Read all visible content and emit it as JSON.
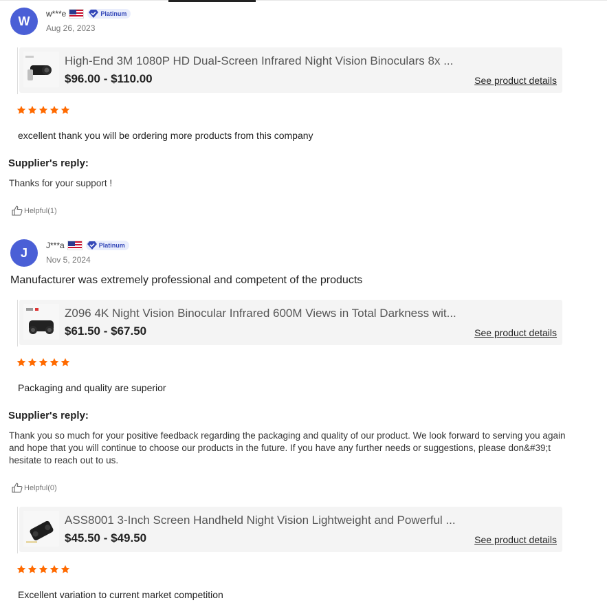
{
  "reviews": [
    {
      "avatar_letter": "W",
      "author": "w***e",
      "country_flag": "us-flag",
      "badge": "Platinum",
      "date": "Aug 26, 2023",
      "text": "",
      "product": {
        "title": "High-End 3M 1080P HD Dual-Screen Infrared Night Vision Binoculars 8x ...",
        "price": "$96.00 - $110.00",
        "details_label": "See product details"
      },
      "rating": 5,
      "comment": "excellent thank you will be ordering more products from this company",
      "reply_heading": "Supplier's reply:",
      "reply": "Thanks for your support !",
      "helpful": "Helpful(1)"
    },
    {
      "avatar_letter": "J",
      "author": "J***a",
      "country_flag": "us-flag",
      "badge": "Platinum",
      "date": "Nov 5, 2024",
      "text": "Manufacturer was extremely professional and competent of the products",
      "product": {
        "title": "Z096 4K Night Vision Binocular Infrared 600M Views in Total Darkness wit...",
        "price": "$61.50 - $67.50",
        "details_label": "See product details"
      },
      "rating": 5,
      "comment": "Packaging and quality are superior",
      "reply_heading": "Supplier's reply:",
      "reply": "Thank you so much for your positive feedback regarding the packaging and quality of our product. We look forward to serving you again and hope that you will continue to choose our products in the future. If you have any further needs or suggestions, please don&#39;t hesitate to reach out to us.",
      "helpful": "Helpful(0)"
    },
    {
      "product": {
        "title": "ASS8001 3-Inch Screen Handheld Night Vision Lightweight and Powerful ...",
        "price": "$45.50 - $49.50",
        "details_label": "See product details"
      },
      "rating": 5,
      "comment": "Excellent variation to current market competition"
    }
  ],
  "colors": {
    "avatar": "#4a5fd6",
    "star": "#ff6a00",
    "badge_bg": "#e9edfc",
    "badge_text": "#3347b8"
  },
  "icons": {
    "badge": "diamond-check-icon",
    "helpful": "thumbs-up-icon",
    "rating": "star-icon"
  }
}
